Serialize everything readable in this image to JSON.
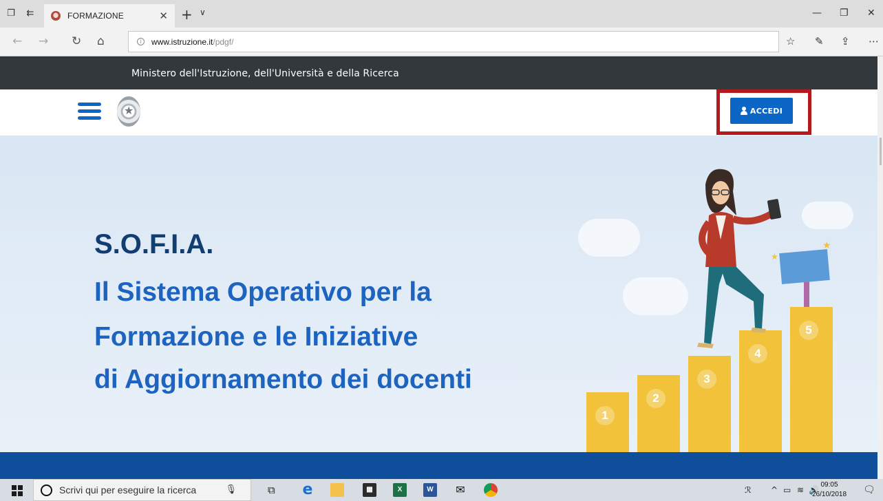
{
  "browser": {
    "tab_title": "FORMAZIONE",
    "url_host": "www.istruzione.it",
    "url_path": "/pdgf/"
  },
  "site": {
    "ministry_text": "Ministero dell'Istruzione, dell'Università e della Ricerca",
    "login_label": "ACCEDI",
    "brand_color": "#0c66c6",
    "highlight_color": "#b3191d"
  },
  "hero": {
    "title": "S.O.F.I.A.",
    "subtitle_lines": [
      "Il Sistema Operativo per la",
      "Formazione e le Iniziative",
      "di Aggiornamento dei docenti"
    ],
    "steps": [
      "1",
      "2",
      "3",
      "4",
      "5"
    ]
  },
  "taskbar": {
    "search_placeholder": "Scrivi qui per eseguire la ricerca",
    "time": "09:05",
    "date": "26/10/2018"
  }
}
